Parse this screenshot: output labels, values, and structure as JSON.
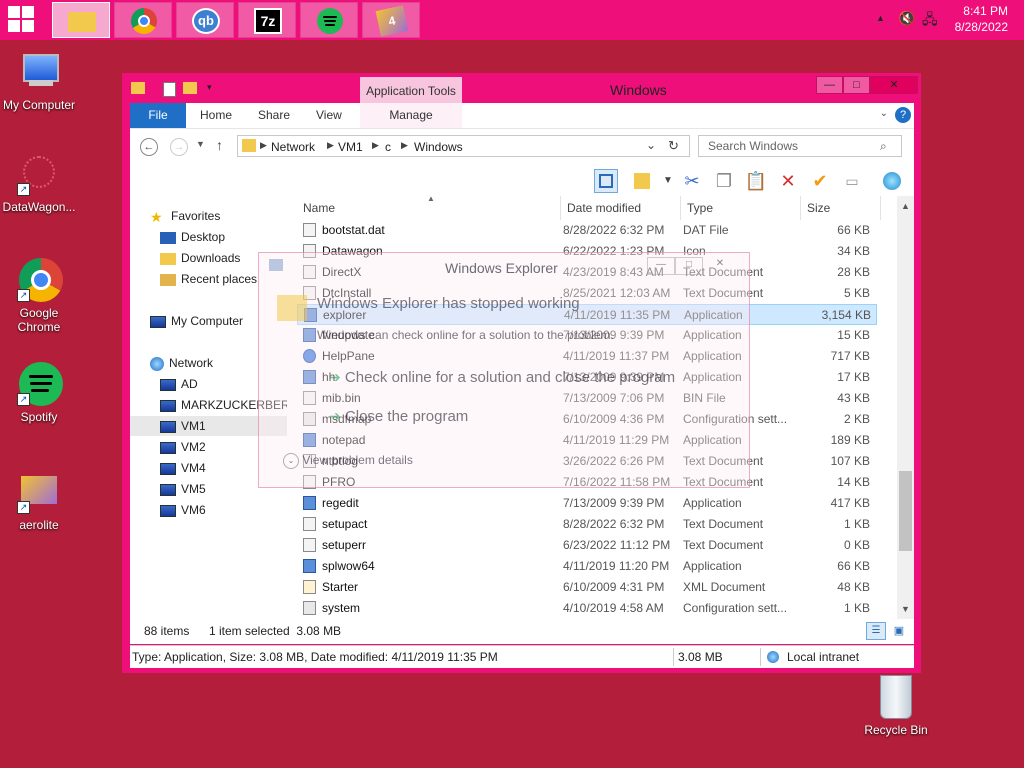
{
  "taskbar": {
    "apps": [
      {
        "name": "file-explorer",
        "active": true
      },
      {
        "name": "chrome",
        "active": false
      },
      {
        "name": "qbittorrent",
        "label": "qb",
        "active": false
      },
      {
        "name": "7zip",
        "label": "7z",
        "active": false
      },
      {
        "name": "spotify",
        "active": false
      },
      {
        "name": "aerolite",
        "label": "4",
        "active": false
      }
    ],
    "clock": {
      "time": "8:41 PM",
      "date": "8/28/2022"
    }
  },
  "desktop": {
    "icons": [
      {
        "label": "My Computer"
      },
      {
        "label": "DataWagon..."
      },
      {
        "label": "Google Chrome"
      },
      {
        "label": "Spotify"
      },
      {
        "label": "aerolite"
      }
    ],
    "recycle_bin": "Recycle Bin"
  },
  "window": {
    "title": "Windows",
    "app_tools": "Application Tools",
    "ribbon_tabs": [
      "File",
      "Home",
      "Share",
      "View",
      "Manage"
    ],
    "breadcrumb": [
      "Network",
      "VM1",
      "c",
      "Windows"
    ],
    "search_placeholder": "Search Windows",
    "columns": {
      "name": "Name",
      "date": "Date modified",
      "type": "Type",
      "size": "Size"
    },
    "nav": {
      "favorites": "Favorites",
      "favorite_items": [
        "Desktop",
        "Downloads",
        "Recent places"
      ],
      "my_computer": "My Computer",
      "network": "Network",
      "network_items": [
        "AD",
        "MARKZUCKERBERG",
        "VM1",
        "VM2",
        "VM4",
        "VM5",
        "VM6"
      ],
      "selected": "VM1"
    },
    "files": [
      {
        "name": "bootstat.dat",
        "date": "8/28/2022 6:32 PM",
        "type": "DAT File",
        "size": "66 KB",
        "icon": "file"
      },
      {
        "name": "Datawagon",
        "date": "6/22/2022 1:23 PM",
        "type": "Icon",
        "size": "34 KB",
        "icon": "icon"
      },
      {
        "name": "DirectX",
        "date": "4/23/2019 8:43 AM",
        "type": "Text Document",
        "size": "28 KB",
        "icon": "file"
      },
      {
        "name": "DtcInstall",
        "date": "8/25/2021 12:03 AM",
        "type": "Text Document",
        "size": "5 KB",
        "icon": "file"
      },
      {
        "name": "explorer",
        "date": "4/11/2019 11:35 PM",
        "type": "Application",
        "size": "3,154 KB",
        "icon": "app",
        "selected": true
      },
      {
        "name": "fveupdate",
        "date": "7/13/2009 9:39 PM",
        "type": "Application",
        "size": "15 KB",
        "icon": "app"
      },
      {
        "name": "HelpPane",
        "date": "4/11/2019 11:37 PM",
        "type": "Application",
        "size": "717 KB",
        "icon": "help"
      },
      {
        "name": "hh",
        "date": "7/13/2009 9:39 PM",
        "type": "Application",
        "size": "17 KB",
        "icon": "app"
      },
      {
        "name": "mib.bin",
        "date": "7/13/2009 7:06 PM",
        "type": "BIN File",
        "size": "43 KB",
        "icon": "file"
      },
      {
        "name": "msdfmap",
        "date": "6/10/2009 4:36 PM",
        "type": "Configuration sett...",
        "size": "2 KB",
        "icon": "cfg"
      },
      {
        "name": "notepad",
        "date": "4/11/2019 11:29 PM",
        "type": "Application",
        "size": "189 KB",
        "icon": "app"
      },
      {
        "name": "ntbtlog",
        "date": "3/26/2022 6:26 PM",
        "type": "Text Document",
        "size": "107 KB",
        "icon": "file"
      },
      {
        "name": "PFRO",
        "date": "7/16/2022 11:58 PM",
        "type": "Text Document",
        "size": "14 KB",
        "icon": "file"
      },
      {
        "name": "regedit",
        "date": "7/13/2009 9:39 PM",
        "type": "Application",
        "size": "417 KB",
        "icon": "app"
      },
      {
        "name": "setupact",
        "date": "8/28/2022 6:32 PM",
        "type": "Text Document",
        "size": "1 KB",
        "icon": "file"
      },
      {
        "name": "setuperr",
        "date": "6/23/2022 11:12 PM",
        "type": "Text Document",
        "size": "0 KB",
        "icon": "file"
      },
      {
        "name": "splwow64",
        "date": "4/11/2019 11:20 PM",
        "type": "Application",
        "size": "66 KB",
        "icon": "app"
      },
      {
        "name": "Starter",
        "date": "6/10/2009 4:31 PM",
        "type": "XML Document",
        "size": "48 KB",
        "icon": "xml"
      },
      {
        "name": "system",
        "date": "4/10/2019 4:58 AM",
        "type": "Configuration sett...",
        "size": "1 KB",
        "icon": "cfg"
      }
    ],
    "status": {
      "items": "88 items",
      "selected": "1 item selected  3.08 MB"
    },
    "details_bar": {
      "info": "Type: Application, Size: 3.08 MB, Date modified: 4/11/2019 11:35 PM",
      "size": "3.08 MB",
      "zone": "Local intranet"
    }
  },
  "dialog": {
    "title": "Windows Explorer",
    "heading": "Windows Explorer has stopped working",
    "message": "Windows can check online for a solution to the problem.",
    "option1": "Check online for a solution and close the program",
    "option2": "Close the program",
    "details": "View problem details"
  },
  "colors": {
    "taskbar": "#ef0f7a",
    "desktop": "#b31f3a",
    "accent": "#1e6fc5"
  }
}
